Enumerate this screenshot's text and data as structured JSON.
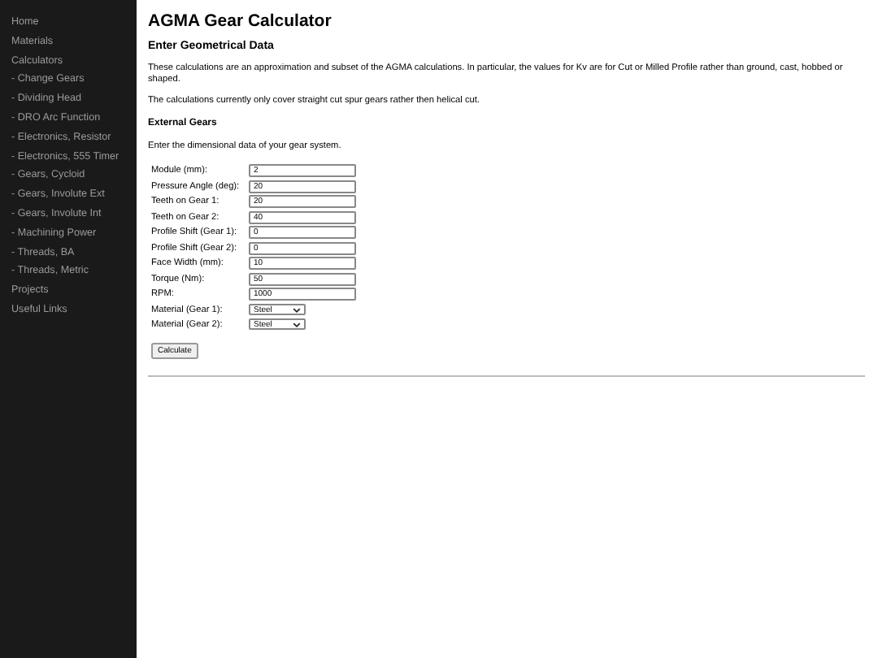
{
  "sidebar": {
    "items": [
      {
        "label": "Home",
        "selected": false
      },
      {
        "label": "Materials",
        "selected": false
      },
      {
        "label": "Calculators",
        "selected": false
      },
      {
        "label": "- Change Gears",
        "selected": false
      },
      {
        "label": "- Dividing Head",
        "selected": false
      },
      {
        "label": "- DRO Arc Function",
        "selected": false
      },
      {
        "label": "- Electronics, Resistor",
        "selected": false
      },
      {
        "label": "- Electronics, 555 Timer",
        "selected": false
      },
      {
        "label": "- Gears, Cycloid",
        "selected": false
      },
      {
        "label": "- Gears, Involute Ext",
        "selected": false
      },
      {
        "label": "- Gears, Involute Int",
        "selected": false
      },
      {
        "label": "- Machining Power",
        "selected": false
      },
      {
        "label": "- Threads, BA",
        "selected": false
      },
      {
        "label": "- Threads, Metric",
        "selected": false
      },
      {
        "label": "Projects",
        "selected": false
      },
      {
        "label": "Useful Links",
        "selected": false
      }
    ]
  },
  "title": "AGMA Gear Calculator",
  "heading": "Enter Geometrical Data",
  "paragraphs": [
    "These calculations are an approximation and subset of the AGMA calculations. In particular, the values for Kv are for Cut or Milled Profile rather than ground, cast, hobbed or shaped.",
    "The calculations currently only cover straight cut spur gears rather then helical cut."
  ],
  "subheading": "External Gears",
  "intro": "Enter the dimensional data of your gear system.",
  "fields": [
    {
      "label": "Module (mm):",
      "kind": "text",
      "value": "2"
    },
    {
      "label": "Pressure Angle (deg):",
      "kind": "text",
      "value": "20"
    },
    {
      "label": "Teeth on Gear 1:",
      "kind": "text",
      "value": "20"
    },
    {
      "label": "Teeth on Gear 2:",
      "kind": "text",
      "value": "40"
    },
    {
      "label": "Profile Shift (Gear 1):",
      "kind": "text",
      "value": "0"
    },
    {
      "label": "Profile Shift (Gear 2):",
      "kind": "text",
      "value": "0"
    },
    {
      "label": "Face Width (mm):",
      "kind": "text",
      "value": "10"
    },
    {
      "label": "Torque (Nm):",
      "kind": "text",
      "value": "50"
    },
    {
      "label": "RPM:",
      "kind": "text",
      "value": "1000"
    },
    {
      "label": "Material (Gear 1):",
      "kind": "select",
      "value": "Steel"
    },
    {
      "label": "Material (Gear 2):",
      "kind": "select",
      "value": "Steel"
    }
  ],
  "button": "Calculate"
}
